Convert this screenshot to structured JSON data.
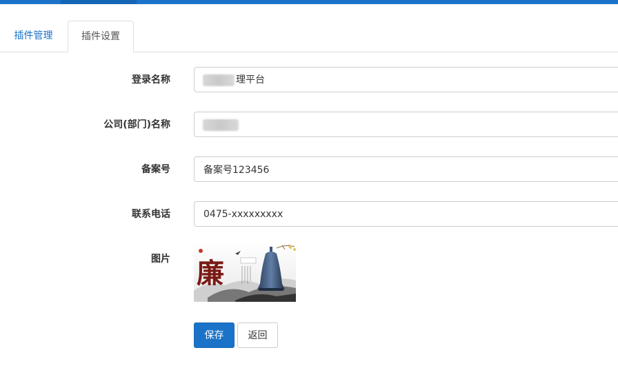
{
  "tabs": [
    {
      "label": "插件管理"
    },
    {
      "label": "插件设置"
    }
  ],
  "form": {
    "login_name": {
      "label": "登录名称",
      "value": "理平台"
    },
    "company_name": {
      "label": "公司(部门)名称",
      "value": ""
    },
    "record_no": {
      "label": "备案号",
      "value": "备案号123456"
    },
    "phone": {
      "label": "联系电话",
      "value": "0475-xxxxxxxxx"
    },
    "image": {
      "label": "图片",
      "title_text": "廉"
    }
  },
  "buttons": {
    "save": "保存",
    "back": "返回"
  },
  "colors": {
    "accent": "#1a73c8",
    "border": "#cccccc"
  }
}
